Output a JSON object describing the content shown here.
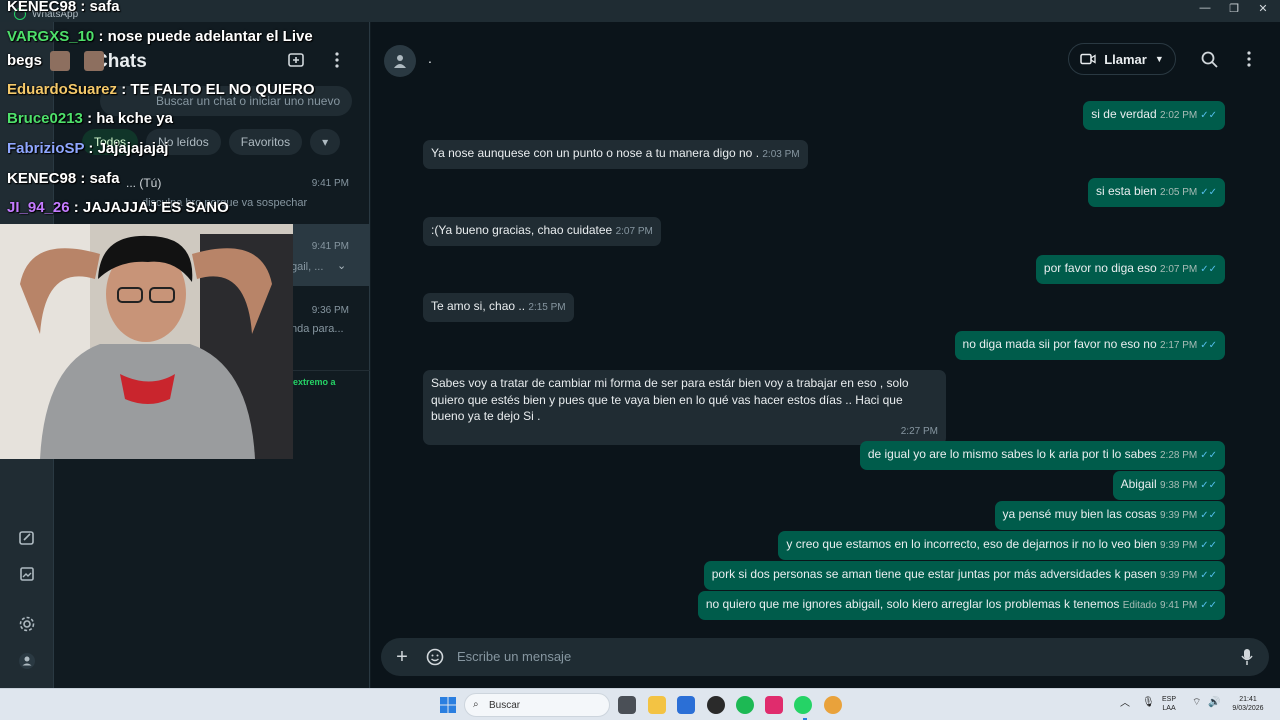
{
  "window": {
    "app_name": "WhatsApp",
    "minimize": "—",
    "maximize": "❐",
    "close": "✕"
  },
  "sidebar": {
    "title": "Chats",
    "search_placeholder": "Buscar un chat o iniciar uno nuevo",
    "filters": [
      "Todos",
      "No leídos",
      "Favoritos"
    ],
    "rows": [
      {
        "preview": "... (Tú)",
        "sub": "disculpa bro porque va sospechar",
        "time": "9:41 PM"
      },
      {
        "preview": "gail, ...",
        "time": "9:41 PM"
      },
      {
        "preview": "nda para...",
        "time": "9:36 PM"
      },
      {
        "preview": "extremo a"
      }
    ]
  },
  "overlay_chat": [
    {
      "user": "KENEC98",
      "msg": ": safa",
      "color": "#ffffff"
    },
    {
      "user": "VARGXS_10",
      "msg": ": nose puede adelantar el Live",
      "color": "#4ee06b"
    },
    {
      "user": "begs",
      "msg": "",
      "color": "#ffffff"
    },
    {
      "user": "EduardoSuarez",
      "msg": ": TE FALTO EL NO QUIERO",
      "color": "#f4c96a"
    },
    {
      "user": "Bruce0213",
      "msg": ": ha kche ya",
      "color": "#4ee06b"
    },
    {
      "user": "FabrizioSP",
      "msg": ": Jajajajajaj",
      "color": "#8fa7ff"
    },
    {
      "user": "KENEC98",
      "msg": ": safa",
      "color": "#ffffff"
    },
    {
      "user": "JI_94_26",
      "msg": ": JAJAJJAJ ES SANO",
      "color": "#c47bff"
    }
  ],
  "chat": {
    "contact_name": ".",
    "call_label": "Llamar",
    "composer_placeholder": "Escribe un mensaje",
    "messages": [
      {
        "dir": "out",
        "text": "si de verdad",
        "time": "2:02 PM"
      },
      {
        "dir": "in",
        "text": "Ya nose aunquese con un punto o nose a tu manera digo no .",
        "time": "2:03 PM"
      },
      {
        "dir": "out",
        "text": "si esta bien",
        "time": "2:05 PM"
      },
      {
        "dir": "in",
        "text": ":(Ya bueno gracias, chao cuidatee",
        "time": "2:07 PM"
      },
      {
        "dir": "out",
        "text": "por favor no diga eso",
        "time": "2:07 PM"
      },
      {
        "dir": "in",
        "text": "Te amo si, chao ..",
        "time": "2:15 PM"
      },
      {
        "dir": "out",
        "text": "no diga mada sii por favor no eso no",
        "time": "2:17 PM"
      },
      {
        "dir": "in",
        "text": "Sabes voy a tratar de cambiar mi forma de ser para estár bien voy a trabajar en eso , solo quiero que estés bien y pues que te vaya bien en lo  qué vas hacer estos días .. Haci que bueno ya te dejo Si .",
        "time": "2:27 PM"
      },
      {
        "dir": "out",
        "text": "de igual yo are lo mismo sabes lo k aria por ti lo sabes",
        "time": "2:28 PM"
      },
      {
        "dir": "out",
        "text": "Abigail",
        "time": "9:38 PM"
      },
      {
        "dir": "out",
        "text": "ya pensé muy bien las cosas",
        "time": "9:39 PM"
      },
      {
        "dir": "out",
        "text": "y creo que estamos en lo incorrecto, eso de dejarnos ir no lo veo bien",
        "time": "9:39 PM"
      },
      {
        "dir": "out",
        "text": "pork si dos personas se aman tiene que estar juntas por más adversidades k pasen",
        "time": "9:39 PM"
      },
      {
        "dir": "out",
        "text": "no quiero que me ignores abigail, solo kiero arreglar los problemas k tenemos",
        "time": "9:41 PM",
        "edited": "Editado"
      }
    ]
  },
  "taskbar": {
    "search_label": "Buscar",
    "lang_top": "ESP",
    "lang_bottom": "LAA",
    "clock_time": "21:41",
    "clock_date": "9/03/2026"
  },
  "colors": {
    "outgoing_bubble": "#005c4b",
    "incoming_bubble": "#202c33",
    "read_ticks": "#53bdeb",
    "background": "#0b141a"
  }
}
